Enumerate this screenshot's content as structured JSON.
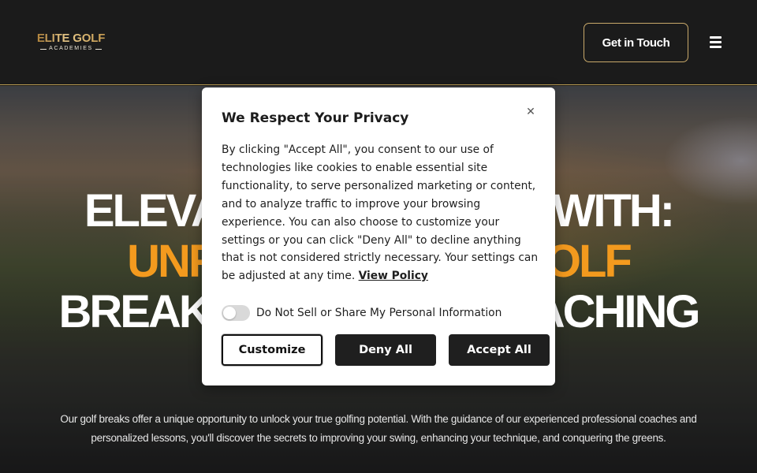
{
  "header": {
    "logo_main": "ELITE GOLF",
    "logo_sub": "ACADEMIES",
    "cta_label": "Get in Touch",
    "menu_icon": "hamburger-icon"
  },
  "hero": {
    "title_line1": "ELEVATE YOUR GAME WITH:",
    "title_line2": "UNFORGETTABLE GOLF",
    "title_line3": "BREAKS & EXPERT COACHING",
    "body": "Our golf breaks offer a unique opportunity to unlock your true golfing potential. With the guidance of our experienced professional coaches and personalized lessons, you'll discover the secrets to improving your swing, enhancing your technique, and conquering the greens."
  },
  "cookie_modal": {
    "title": "We Respect Your Privacy",
    "body": "By clicking \"Accept All\", you consent to our use of technologies like cookies to enable essential site functionality, to serve personalized marketing or content, and to analyze traffic to improve your browsing experience. You can also choose to customize your settings or you can click \"Deny All\" to decline anything that is not considered strictly necessary. Your settings can be adjusted at any time.",
    "policy_link": "View Policy",
    "toggle_label": "Do Not Sell or Share My Personal Information",
    "toggle_on": false,
    "close_icon": "close-icon",
    "buttons": {
      "customize": "Customize",
      "deny": "Deny All",
      "accept": "Accept All"
    }
  },
  "colors": {
    "accent_orange": "#f39a1e",
    "gold": "#c9a96a",
    "header_bg": "#1b1b1b",
    "button_dark": "#1f1f1f"
  }
}
